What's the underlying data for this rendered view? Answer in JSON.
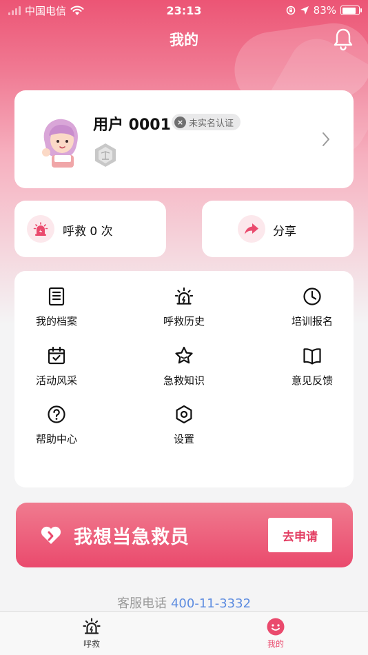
{
  "status_bar": {
    "carrier": "中国电信",
    "time": "23:13",
    "battery": "83%"
  },
  "header": {
    "title": "我的"
  },
  "profile": {
    "username": "用户 0001",
    "verify_badge": "未实名认证"
  },
  "actions": {
    "call_label": "呼救 0 次",
    "share_label": "分享"
  },
  "menu": {
    "items": [
      {
        "label": "我的档案",
        "icon": "document-icon"
      },
      {
        "label": "呼救历史",
        "icon": "alarm-icon"
      },
      {
        "label": "培训报名",
        "icon": "clock-icon"
      },
      {
        "label": "活动风采",
        "icon": "calendar-check-icon"
      },
      {
        "label": "急救知识",
        "icon": "star-icon"
      },
      {
        "label": "意见反馈",
        "icon": "book-icon"
      },
      {
        "label": "帮助中心",
        "icon": "question-icon"
      },
      {
        "label": "设置",
        "icon": "settings-icon"
      }
    ]
  },
  "apply_banner": {
    "title": "我想当急救员",
    "button_label": "去申请"
  },
  "hotline": {
    "label": "客服电话",
    "number": "400-11-3332"
  },
  "tabbar": {
    "tabs": [
      {
        "label": "呼救",
        "active": false
      },
      {
        "label": "我的",
        "active": true
      }
    ]
  },
  "colors": {
    "accent": "#ea4a6d",
    "link": "#5d8ce0"
  }
}
